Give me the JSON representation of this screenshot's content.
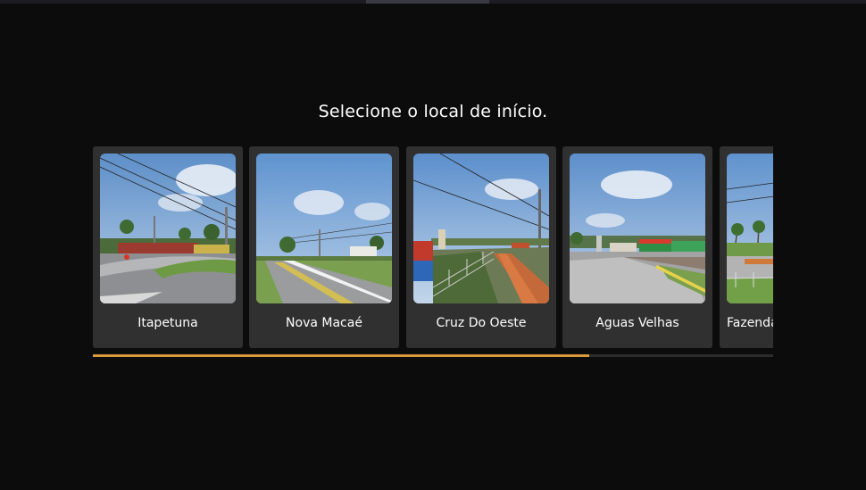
{
  "screen": {
    "title": "Selecione o local de início."
  },
  "locations": [
    {
      "name": "Itapetuna"
    },
    {
      "name": "Nova Macaé"
    },
    {
      "name": "Cruz Do Oeste"
    },
    {
      "name": "Aguas Velhas"
    },
    {
      "name": "Fazenda"
    }
  ],
  "scroll": {
    "position_fraction": 0.73
  },
  "colors": {
    "background": "#0c0c0c",
    "card": "#303030",
    "accent": "#d89a3a"
  }
}
